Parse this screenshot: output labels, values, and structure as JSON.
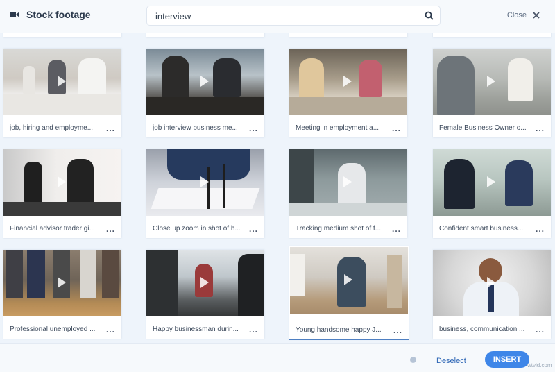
{
  "header": {
    "title": "Stock footage",
    "icon": "video-camera-icon",
    "search_value": "interview",
    "close_label": "Close"
  },
  "cards": [
    {
      "caption": "job, hiring and employme...",
      "more": "..."
    },
    {
      "caption": "job interview business me...",
      "more": "..."
    },
    {
      "caption": "Meeting in employment a...",
      "more": "..."
    },
    {
      "caption": "Female Business Owner o...",
      "more": "..."
    },
    {
      "caption": "Financial advisor trader gi...",
      "more": "..."
    },
    {
      "caption": "Close up zoom in shot of h...",
      "more": "..."
    },
    {
      "caption": "Tracking medium shot of f...",
      "more": "..."
    },
    {
      "caption": "Confident smart business...",
      "more": "..."
    },
    {
      "caption": "Professional unemployed ...",
      "more": "..."
    },
    {
      "caption": "Happy businessman durin...",
      "more": "..."
    },
    {
      "caption": "Young handsome happy J...",
      "more": "...",
      "selected": true
    },
    {
      "caption": "business, communication ...",
      "more": "..."
    }
  ],
  "footer": {
    "deselect_label": "Deselect",
    "insert_label": "INSERT"
  },
  "watermark": "wtvid.com",
  "colors": {
    "accent": "#3e86e8",
    "link": "#2d66b5",
    "background": "#eef4fb"
  }
}
